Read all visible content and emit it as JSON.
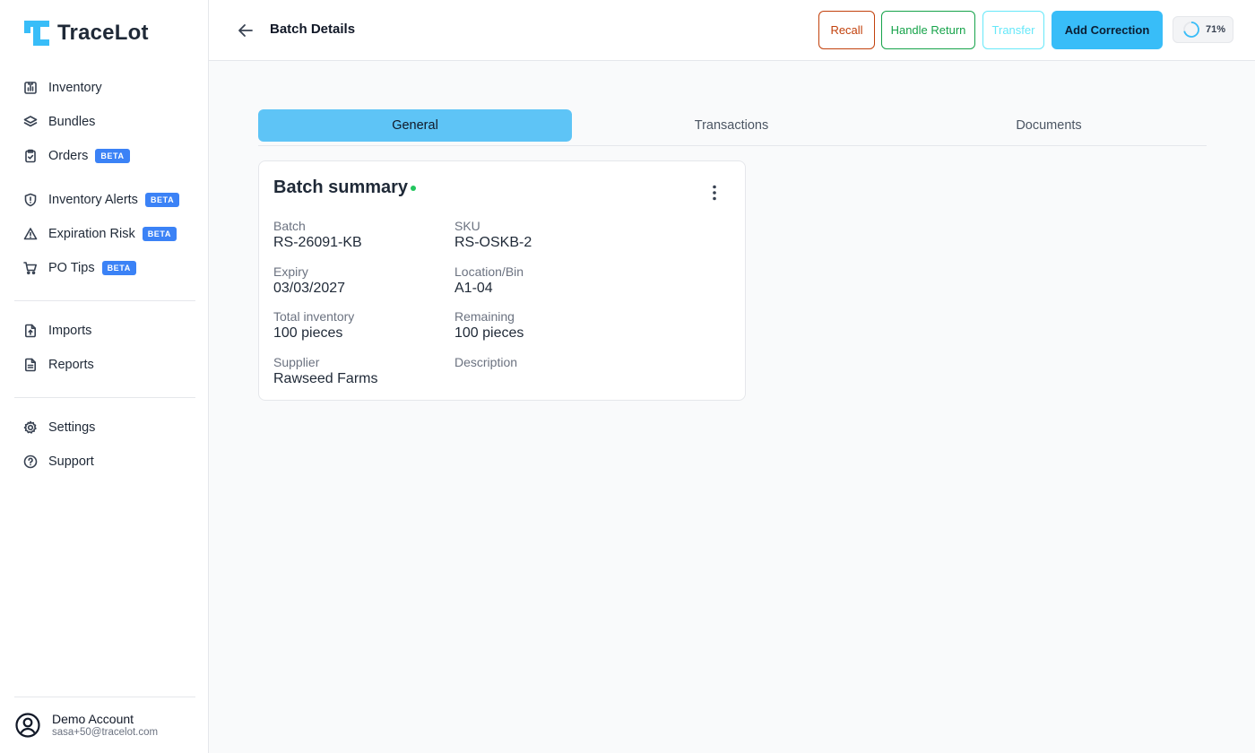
{
  "app": {
    "name": "TraceLot"
  },
  "sidebar": {
    "groups": [
      [
        {
          "label": "Inventory",
          "icon": "inventory-icon",
          "beta": false
        },
        {
          "label": "Bundles",
          "icon": "layers-icon",
          "beta": false
        },
        {
          "label": "Orders",
          "icon": "clipboard-check-icon",
          "beta": true
        }
      ],
      [
        {
          "label": "Inventory Alerts",
          "icon": "shield-alert-icon",
          "beta": true
        },
        {
          "label": "Expiration Risk",
          "icon": "warning-triangle-icon",
          "beta": true
        },
        {
          "label": "PO Tips",
          "icon": "cart-icon",
          "beta": true
        }
      ],
      [
        {
          "label": "Imports",
          "icon": "file-upload-icon",
          "beta": false
        },
        {
          "label": "Reports",
          "icon": "file-text-icon",
          "beta": false
        }
      ],
      [
        {
          "label": "Settings",
          "icon": "gear-icon",
          "beta": false
        },
        {
          "label": "Support",
          "icon": "help-circle-icon",
          "beta": false
        }
      ]
    ],
    "beta_label": "BETA",
    "account": {
      "name": "Demo Account",
      "email": "sasa+50@tracelot.com"
    }
  },
  "header": {
    "title": "Batch Details",
    "buttons": {
      "recall": "Recall",
      "handle_return": "Handle Return",
      "transfer": "Transfer",
      "add_correction": "Add Correction"
    },
    "progress": {
      "value": 0.71,
      "label": "71%"
    }
  },
  "tabs": {
    "general": "General",
    "transactions": "Transactions",
    "documents": "Documents",
    "active": "general"
  },
  "card": {
    "title": "Batch summary",
    "fields": {
      "batch": {
        "label": "Batch",
        "value": "RS-26091-KB"
      },
      "sku": {
        "label": "SKU",
        "value": "RS-OSKB-2"
      },
      "expiry": {
        "label": "Expiry",
        "value": "03/03/2027"
      },
      "location": {
        "label": "Location/Bin",
        "value": "A1-04"
      },
      "total_inventory": {
        "label": "Total inventory",
        "value": "100 pieces"
      },
      "remaining": {
        "label": "Remaining",
        "value": "100 pieces"
      },
      "supplier": {
        "label": "Supplier",
        "value": "Rawseed Farms"
      },
      "description": {
        "label": "Description",
        "value": ""
      }
    }
  },
  "colors": {
    "accent": "#38bdf8",
    "active_tab": "#5ec4f6",
    "recall": "#c2410c",
    "handle_return": "#16a34a",
    "transfer": "#67e8f9",
    "beta_badge": "#3b82f6",
    "status_dot": "#22c55e"
  }
}
